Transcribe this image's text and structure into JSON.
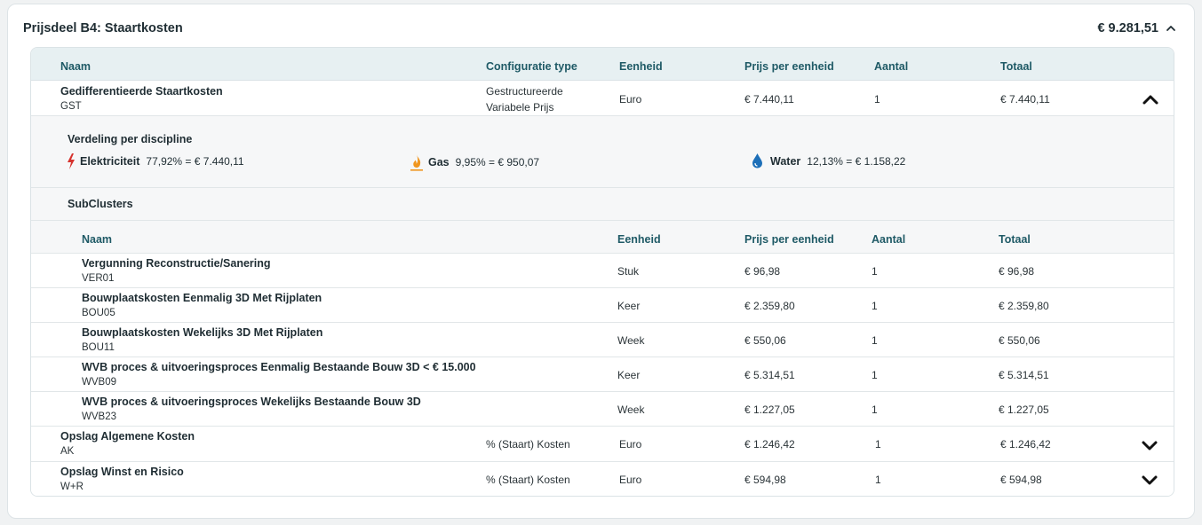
{
  "header": {
    "title": "Prijsdeel B4: Staartkosten",
    "total": "€ 9.281,51"
  },
  "columns": {
    "naam": "Naam",
    "config": "Configuratie type",
    "eenheid": "Eenheid",
    "prijs": "Prijs per eenheid",
    "aantal": "Aantal",
    "totaal": "Totaal"
  },
  "main_row": {
    "name": "Gedifferentieerde Staartkosten",
    "code": "GST",
    "config_line1": "Gestructureerde",
    "config_line2": "Variabele Prijs",
    "eenheid": "Euro",
    "prijs": "€ 7.440,11",
    "aantal": "1",
    "totaal": "€ 7.440,11"
  },
  "distribution": {
    "title": "Verdeling per discipline",
    "items": [
      {
        "label": "Elektriciteit",
        "value": "77,92% = € 7.440,11",
        "icon": "lightning-icon",
        "color": "#d6322d"
      },
      {
        "label": "Gas",
        "value": "9,95% = € 950,07",
        "icon": "flame-icon",
        "color": "#f0961e"
      },
      {
        "label": "Water",
        "value": "12,13% = € 1.158,22",
        "icon": "water-drop-icon",
        "color": "#1d6fb8"
      }
    ]
  },
  "subclusters": {
    "title": "SubClusters",
    "columns": {
      "naam": "Naam",
      "eenheid": "Eenheid",
      "prijs": "Prijs per eenheid",
      "aantal": "Aantal",
      "totaal": "Totaal"
    },
    "rows": [
      {
        "name": "Vergunning Reconstructie/Sanering",
        "code": "VER01",
        "eenheid": "Stuk",
        "prijs": "€ 96,98",
        "aantal": "1",
        "totaal": "€ 96,98"
      },
      {
        "name": "Bouwplaatskosten Eenmalig 3D Met Rijplaten",
        "code": "BOU05",
        "eenheid": "Keer",
        "prijs": "€ 2.359,80",
        "aantal": "1",
        "totaal": "€ 2.359,80"
      },
      {
        "name": "Bouwplaatskosten Wekelijks 3D Met Rijplaten",
        "code": "BOU11",
        "eenheid": "Week",
        "prijs": "€ 550,06",
        "aantal": "1",
        "totaal": "€ 550,06"
      },
      {
        "name": "WVB proces & uitvoeringsproces Eenmalig Bestaande Bouw 3D < € 15.000",
        "code": "WVB09",
        "eenheid": "Keer",
        "prijs": "€ 5.314,51",
        "aantal": "1",
        "totaal": "€ 5.314,51"
      },
      {
        "name": "WVB proces & uitvoeringsproces Wekelijks Bestaande Bouw 3D",
        "code": "WVB23",
        "eenheid": "Week",
        "prijs": "€ 1.227,05",
        "aantal": "1",
        "totaal": "€ 1.227,05"
      }
    ]
  },
  "extra_rows": [
    {
      "name": "Opslag Algemene Kosten",
      "code": "AK",
      "config": "% (Staart) Kosten",
      "eenheid": "Euro",
      "prijs": "€ 1.246,42",
      "aantal": "1",
      "totaal": "€ 1.246,42"
    },
    {
      "name": "Opslag Winst en Risico",
      "code": "W+R",
      "config": "% (Staart) Kosten",
      "eenheid": "Euro",
      "prijs": "€ 594,98",
      "aantal": "1",
      "totaal": "€ 594,98"
    }
  ]
}
